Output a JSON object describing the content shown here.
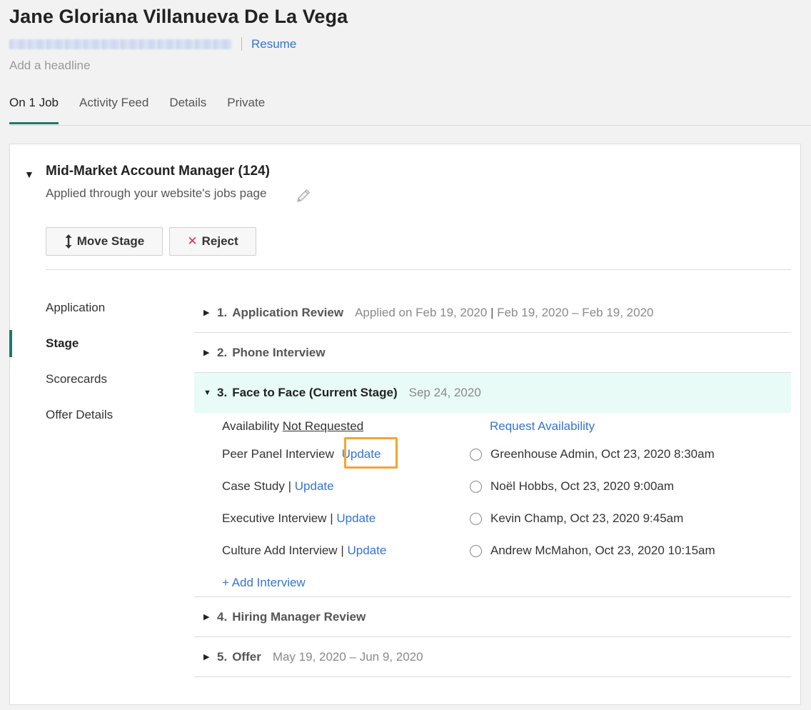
{
  "candidate": {
    "name": "Jane Gloriana Villanueva De La Vega",
    "resume_label": "Resume",
    "headline_placeholder": "Add a headline"
  },
  "tabs": [
    {
      "label": "On 1 Job",
      "active": true
    },
    {
      "label": "Activity Feed",
      "active": false
    },
    {
      "label": "Details",
      "active": false
    },
    {
      "label": "Private",
      "active": false
    }
  ],
  "job": {
    "title": "Mid-Market Account Manager (124)",
    "source": "Applied through your website's jobs page",
    "move_stage_label": "Move Stage",
    "reject_label": "Reject"
  },
  "sidebar": {
    "items": [
      {
        "label": "Application"
      },
      {
        "label": "Stage"
      },
      {
        "label": "Scorecards"
      },
      {
        "label": "Offer Details"
      }
    ],
    "active": "Stage"
  },
  "stages": [
    {
      "num": "1.",
      "name": "Application Review",
      "meta_a": "Applied on Feb 19, 2020",
      "meta_sep": "|",
      "meta_b": "Feb 19, 2020 – Feb 19, 2020"
    },
    {
      "num": "2.",
      "name": "Phone Interview"
    },
    {
      "num": "3.",
      "name": "Face to Face (Current Stage)",
      "meta_a": "Sep 24, 2020"
    },
    {
      "num": "4.",
      "name": "Hiring Manager Review"
    },
    {
      "num": "5.",
      "name": "Offer",
      "meta_a": "May 19, 2020 – Jun 9, 2020"
    }
  ],
  "current_stage": {
    "availability_label": "Availability",
    "availability_status": "Not Requested",
    "request_availability_label": "Request Availability",
    "update_label": "Update",
    "pipe": "|",
    "interviews": [
      {
        "name": "Peer Panel Interview",
        "schedule": "Greenhouse Admin, Oct 23, 2020 8:30am"
      },
      {
        "name": "Case Study",
        "schedule": "Noël Hobbs, Oct 23, 2020 9:00am"
      },
      {
        "name": "Executive Interview",
        "schedule": "Kevin Champ, Oct 23, 2020 9:45am"
      },
      {
        "name": "Culture Add Interview",
        "schedule": "Andrew McMahon, Oct 23, 2020 10:15am"
      }
    ],
    "add_interview_label": "+ Add Interview"
  },
  "colors": {
    "accent": "#1d7a68",
    "link": "#3574d4",
    "current_stage_bg": "#e8fbf6",
    "highlight": "#f4a530",
    "reject": "#d9354a"
  }
}
